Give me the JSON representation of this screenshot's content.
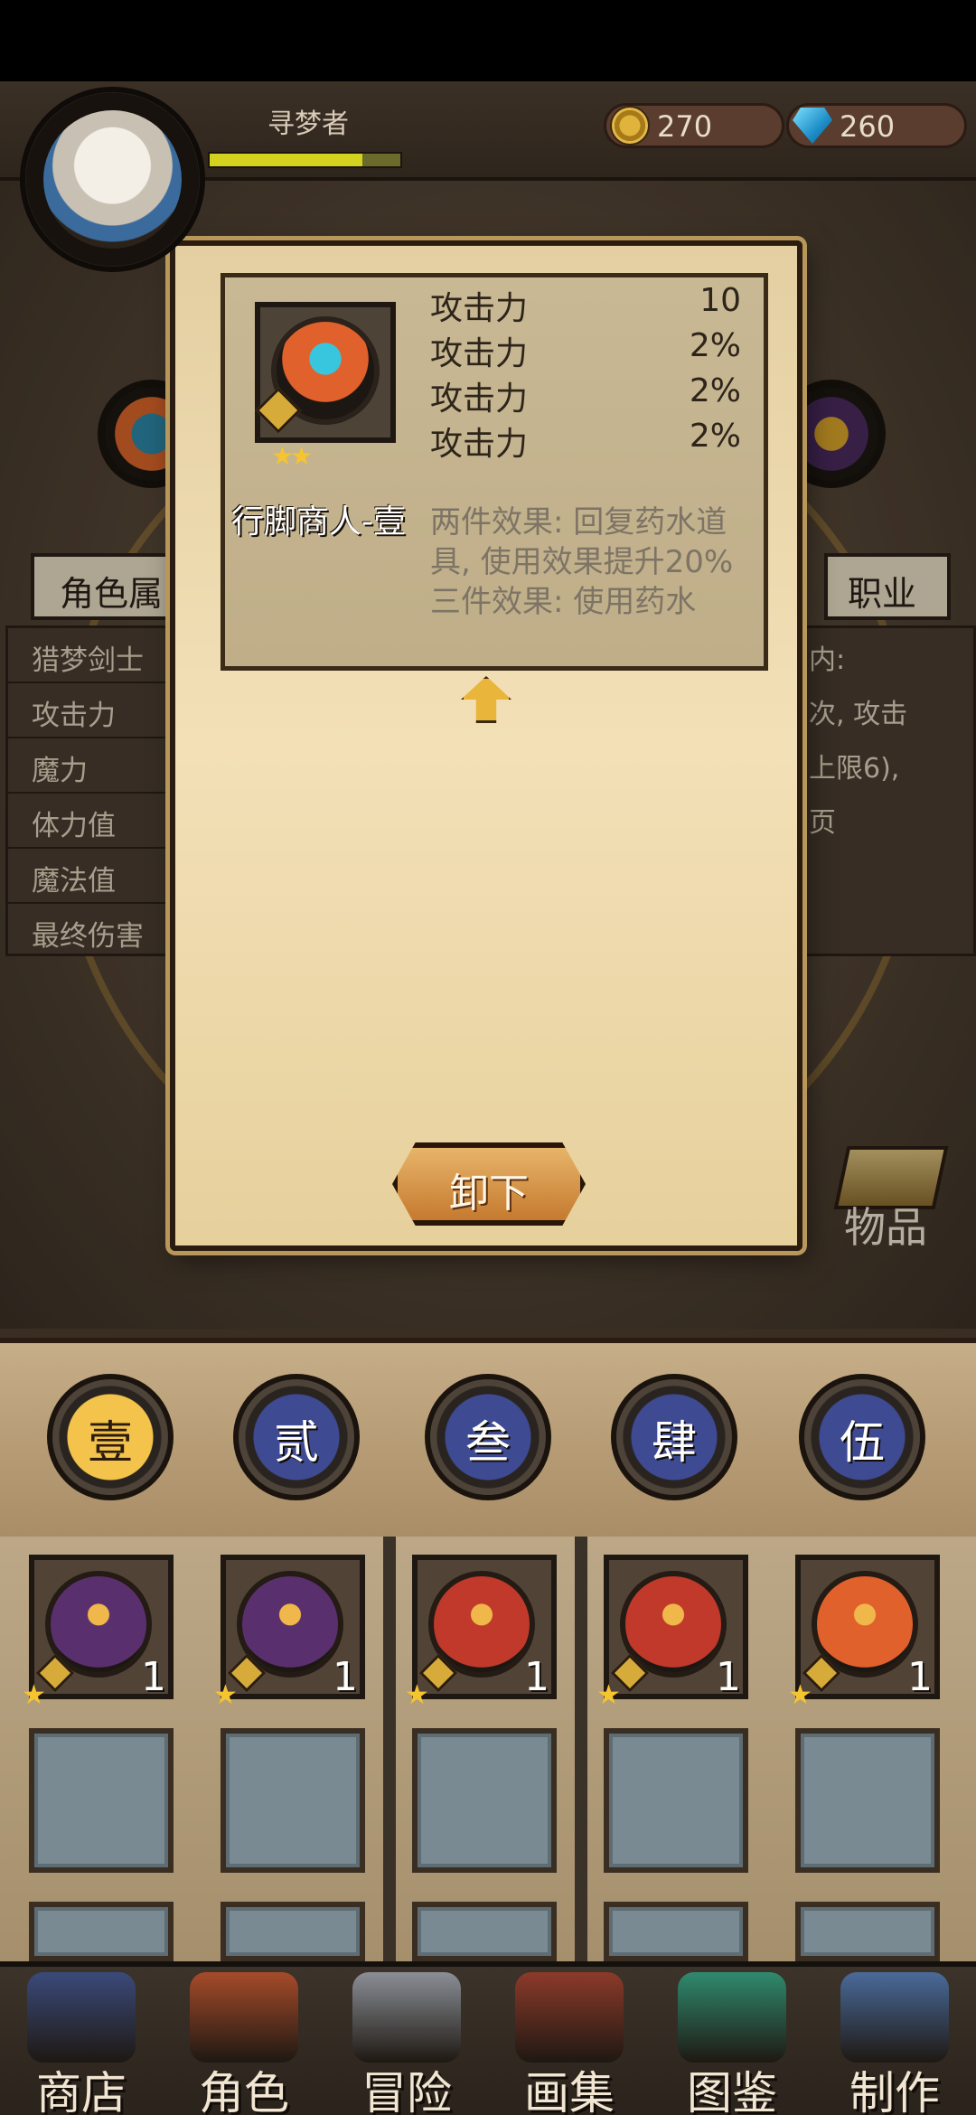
{
  "header": {
    "player_name": "寻梦者",
    "gold": "270",
    "gems": "260",
    "xp_fraction": 0.8
  },
  "background_page": {
    "left_tab": "角色属",
    "right_tab": "职业",
    "stats": [
      "猎梦剑士",
      "攻击力",
      "魔力",
      "体力值",
      "魔法值",
      "最终伤害"
    ],
    "desc_lines": [
      "内:",
      "次, 攻击",
      "上限6),",
      "页"
    ],
    "items_label": "物品"
  },
  "modal": {
    "set_name": "行脚商人-壹",
    "stars": "★★",
    "stats": [
      {
        "name": "攻击力",
        "value": "10"
      },
      {
        "name": "攻击力",
        "value": "2%"
      },
      {
        "name": "攻击力",
        "value": "2%"
      },
      {
        "name": "攻击力",
        "value": "2%"
      }
    ],
    "effects": "两件效果: 回复药水道具, 使用效果提升20% 三件效果: 使用药水",
    "unequip_label": "卸下"
  },
  "sets": [
    "壹",
    "贰",
    "叁",
    "肆",
    "伍"
  ],
  "active_set": 0,
  "inventory": [
    {
      "count": "1",
      "stars": "★",
      "color": "#5a2f6e"
    },
    {
      "count": "1",
      "stars": "★",
      "color": "#5a2f6e"
    },
    {
      "count": "1",
      "stars": "★",
      "color": "#c0392b"
    },
    {
      "count": "1",
      "stars": "★",
      "color": "#c0392b"
    },
    {
      "count": "1",
      "stars": "★",
      "color": "#e0612b"
    }
  ],
  "nav": [
    {
      "label": "商店",
      "icon": "castle-icon",
      "color": "#3a4a7a"
    },
    {
      "label": "角色",
      "icon": "cat-mask-icon",
      "color": "#a64b2a"
    },
    {
      "label": "冒险",
      "icon": "crossed-swords-icon",
      "color": "#8a8f96"
    },
    {
      "label": "画集",
      "icon": "book-icon",
      "color": "#8c3a2a"
    },
    {
      "label": "图鉴",
      "icon": "card-icon",
      "color": "#2f8a6e"
    },
    {
      "label": "制作",
      "icon": "hammer-icon",
      "color": "#4a6a9a"
    }
  ]
}
